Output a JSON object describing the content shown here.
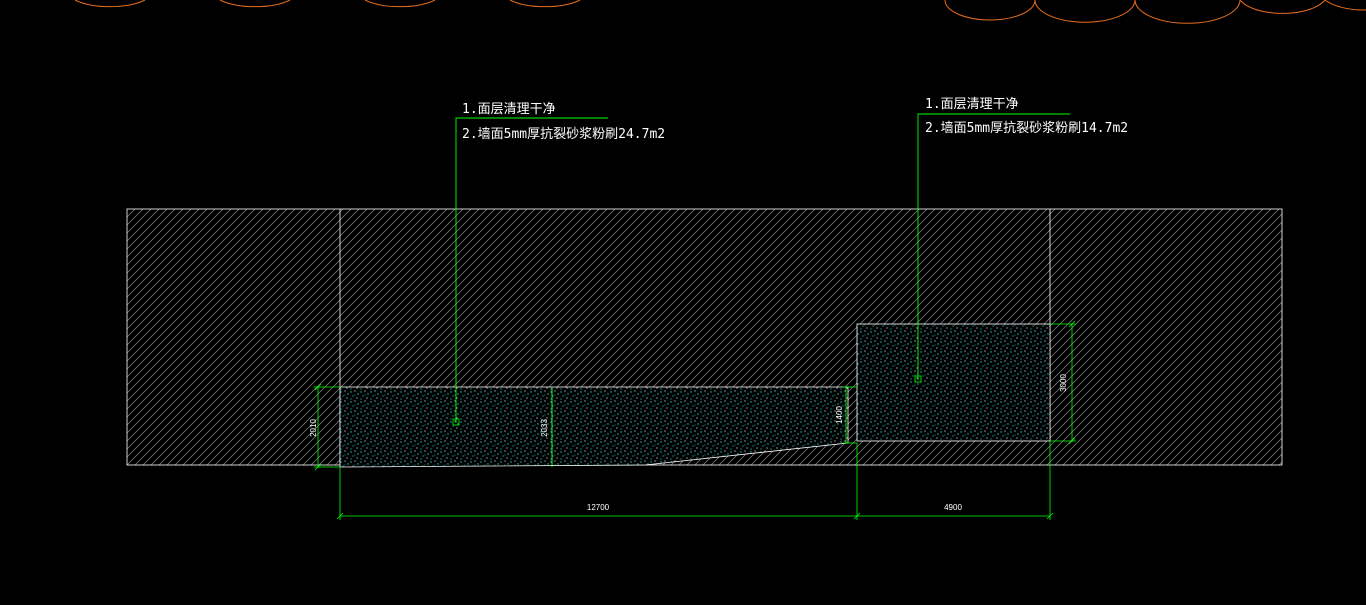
{
  "colors": {
    "background": "#000000",
    "wall_outline": "#ffffff",
    "hatch": "#8a8a8a",
    "leader": "#00ff00",
    "dimension": "#00ff00",
    "fill_dots": "#27c7c7",
    "arcs": "#e8701e",
    "text": "#ffffff"
  },
  "notes": [
    {
      "line1": "1.面层清理干净",
      "line2": "2.墙面5mm厚抗裂砂浆粉刷24.7m2"
    },
    {
      "line1": "1.面层清理干净",
      "line2": "2.墙面5mm厚抗裂砂浆粉刷14.7m2"
    }
  ],
  "dimensions": {
    "left_height": "2010",
    "mid_height": "2033",
    "step_height": "1400",
    "right_height": "3000",
    "left_width": "12700",
    "right_width": "4900"
  }
}
